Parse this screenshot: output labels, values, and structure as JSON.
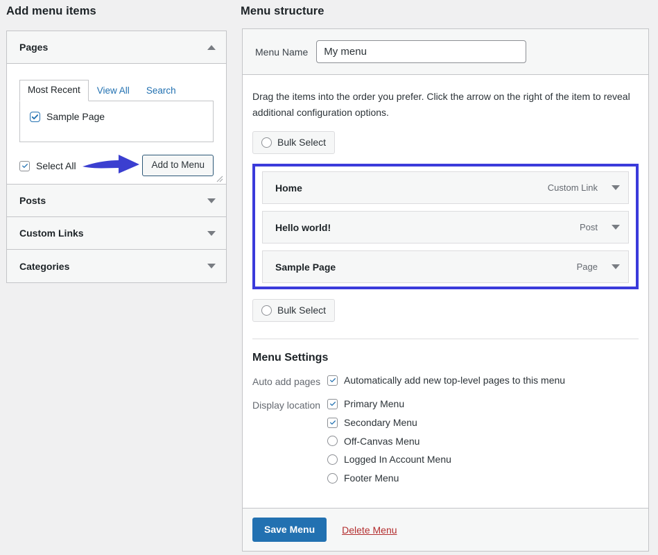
{
  "add_menu_items": {
    "title": "Add menu items",
    "panels": [
      {
        "label": "Pages",
        "expanded": true,
        "caret_icon": "caret-up-icon"
      },
      {
        "label": "Posts",
        "expanded": false,
        "caret_icon": "caret-down-icon"
      },
      {
        "label": "Custom Links",
        "expanded": false,
        "caret_icon": "caret-down-icon"
      },
      {
        "label": "Categories",
        "expanded": false,
        "caret_icon": "caret-down-icon"
      }
    ],
    "pages_panel": {
      "tabs": [
        {
          "label": "Most Recent",
          "active": true
        },
        {
          "label": "View All",
          "active": false
        },
        {
          "label": "Search",
          "active": false
        }
      ],
      "items": [
        {
          "label": "Sample Page",
          "checked": true
        }
      ],
      "select_all": {
        "label": "Select All",
        "checked": true
      },
      "add_to_menu_button": "Add to Menu",
      "resize_handle_icon": "resize-handle-icon"
    },
    "annotation": {
      "arrow_icon": "arrow-right-icon",
      "color": "#3b3fd0"
    }
  },
  "menu_structure": {
    "title": "Menu structure",
    "menu_name": {
      "label": "Menu Name",
      "value": "My menu",
      "placeholder": "Menu Name"
    },
    "hint": "Drag the items into the order you prefer. Click the arrow on the right of the item to reveal additional configuration options.",
    "bulk_select_top": {
      "label": "Bulk Select",
      "checked": false
    },
    "bulk_select_bottom": {
      "label": "Bulk Select",
      "checked": false
    },
    "highlight_color": "#3b3bdb",
    "items": [
      {
        "title": "Home",
        "type": "Custom Link",
        "caret_icon": "caret-down-icon"
      },
      {
        "title": "Hello world!",
        "type": "Post",
        "caret_icon": "caret-down-icon"
      },
      {
        "title": "Sample Page",
        "type": "Page",
        "caret_icon": "caret-down-icon"
      }
    ],
    "settings": {
      "heading": "Menu Settings",
      "auto_add": {
        "label": "Auto add pages",
        "option": {
          "label": "Automatically add new top-level pages to this menu",
          "checked": true
        }
      },
      "display_location": {
        "label": "Display location",
        "options": [
          {
            "label": "Primary Menu",
            "checked": true
          },
          {
            "label": "Secondary Menu",
            "checked": true
          },
          {
            "label": "Off-Canvas Menu",
            "checked": false
          },
          {
            "label": "Logged In Account Menu",
            "checked": false
          },
          {
            "label": "Footer Menu",
            "checked": false
          }
        ]
      }
    },
    "footer": {
      "save_label": "Save Menu",
      "delete_label": "Delete Menu",
      "save_color": "#2271b1",
      "delete_color": "#b32d2e"
    }
  }
}
